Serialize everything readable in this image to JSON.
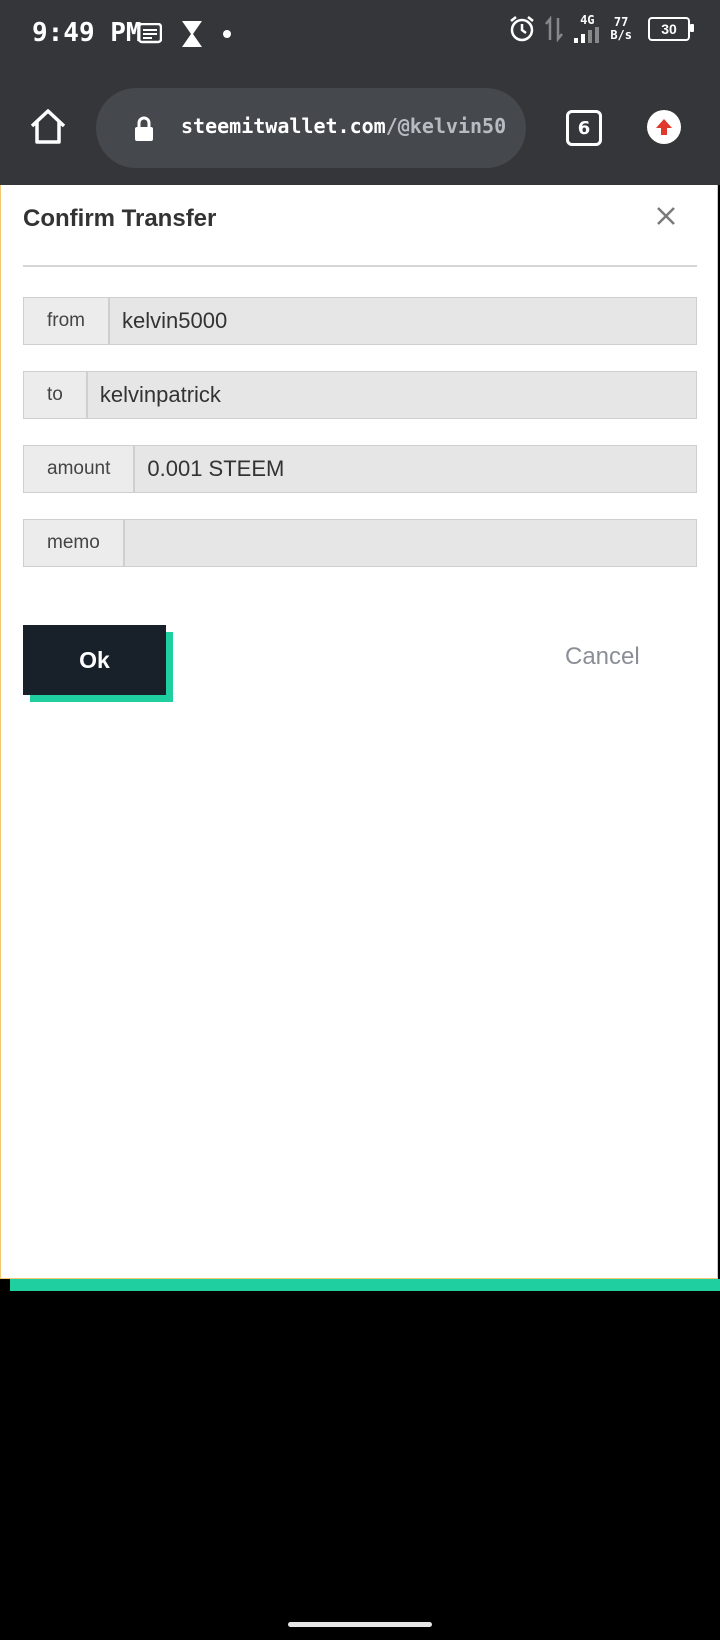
{
  "status_bar": {
    "time": "9:49 PM",
    "network_type": "4G",
    "speed_value": "77",
    "speed_unit": "B/s",
    "battery": "30"
  },
  "browser": {
    "url_host": "steemitwallet.com",
    "url_path": "/@kelvin50",
    "tab_count": "6"
  },
  "modal": {
    "title": "Confirm Transfer",
    "fields": [
      {
        "label": "from",
        "value": "kelvin5000"
      },
      {
        "label": "to",
        "value": "kelvinpatrick"
      },
      {
        "label": "amount",
        "value": "0.001 STEEM"
      },
      {
        "label": "memo",
        "value": ""
      }
    ],
    "ok_label": "Ok",
    "cancel_label": "Cancel"
  },
  "colors": {
    "accent": "#1fcfa0",
    "ok_button": "#18202a",
    "bar_bg": "#34363a",
    "update_icon": "#e0392b"
  }
}
